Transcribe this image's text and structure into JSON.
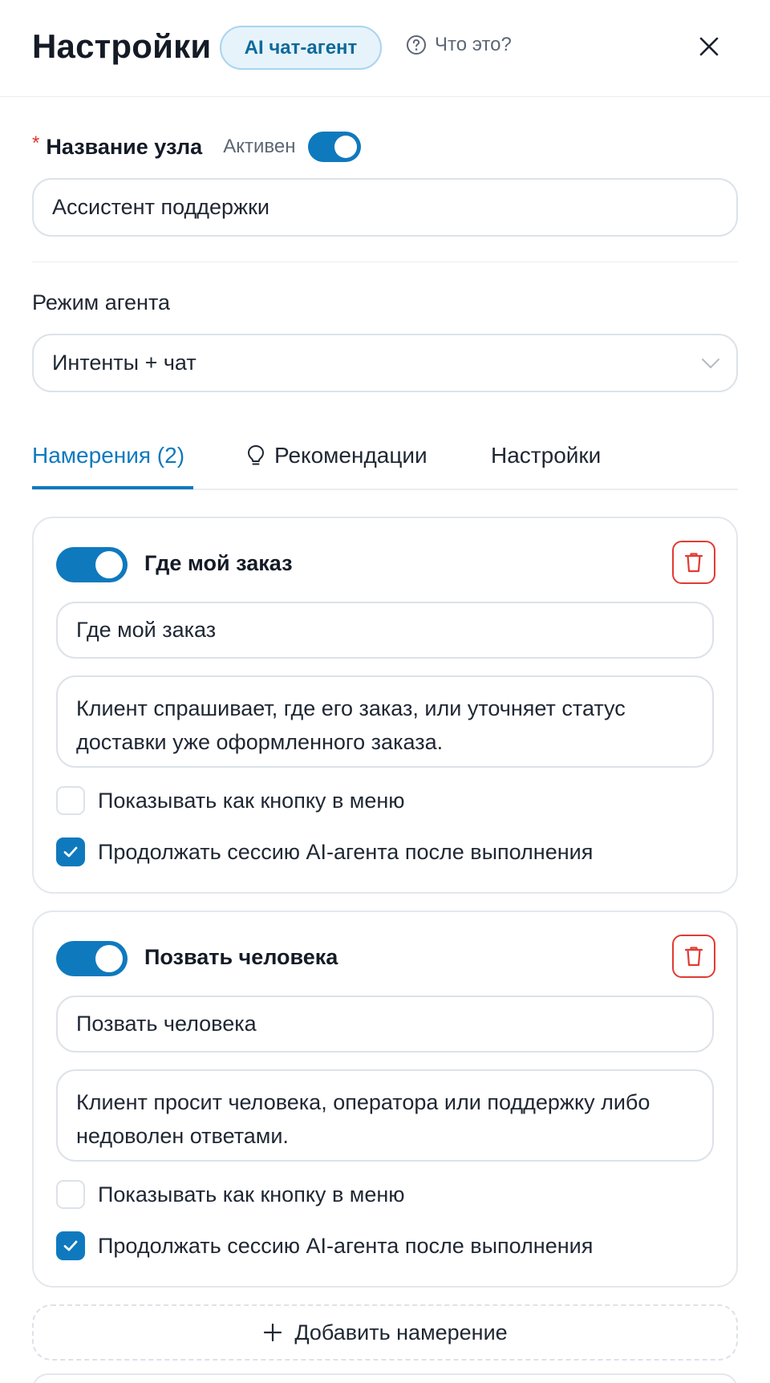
{
  "header": {
    "title": "Настройки",
    "badge": "AI чат-агент",
    "help_text": "Что это?"
  },
  "node": {
    "label": "Название узла",
    "required_mark": "*",
    "active_label": "Активен",
    "active": true,
    "name_value": "Ассистент поддержки"
  },
  "mode": {
    "label": "Режим агента",
    "selected": "Интенты + чат"
  },
  "tabs": [
    {
      "label": "Намерения (2)",
      "active": true
    },
    {
      "label": "Рекомендации",
      "icon": "lightbulb-icon"
    },
    {
      "label": "Настройки"
    }
  ],
  "intents": [
    {
      "enabled": true,
      "title": "Где мой заказ",
      "name_value": "Где мой заказ",
      "description": "Клиент спрашивает, где его заказ, или уточняет статус доставки уже оформленного заказа.",
      "show_as_menu_button": {
        "label": "Показывать как кнопку в меню",
        "checked": false
      },
      "continue_session": {
        "label": "Продолжать сессию AI-агента после выполнения",
        "checked": true
      }
    },
    {
      "enabled": true,
      "title": "Позвать человека",
      "name_value": "Позвать человека",
      "description": "Клиент просит человека, оператора или поддержку либо недоволен ответами.",
      "show_as_menu_button": {
        "label": "Показывать как кнопку в меню",
        "checked": false
      },
      "continue_session": {
        "label": "Продолжать сессию AI-агента после выполнения",
        "checked": true
      }
    }
  ],
  "add_intent_label": "Добавить намерение",
  "colors": {
    "accent": "#0f79be",
    "danger": "#e13b33",
    "badge_bg": "#e6f3fb",
    "border": "#dde2e8"
  }
}
